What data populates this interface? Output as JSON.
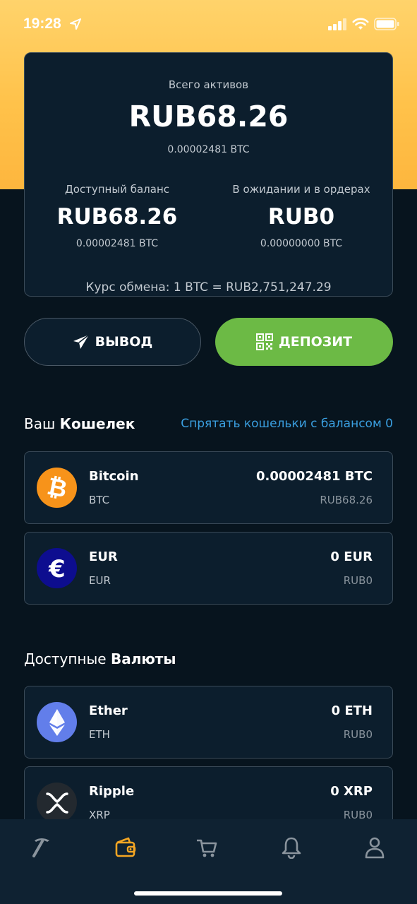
{
  "status_bar": {
    "time": "19:28"
  },
  "summary": {
    "total_label": "Всего активов",
    "total_value": "RUB68.26",
    "total_btc": "0.00002481 BTC",
    "available_label": "Доступный баланс",
    "available_value": "RUB68.26",
    "available_btc": "0.00002481 BTC",
    "pending_label": "В ожидании и в ордерах",
    "pending_value": "RUB0",
    "pending_btc": "0.00000000 BTC",
    "rate": "Курс обмена: 1 BTC = RUB2,751,247.29"
  },
  "actions": {
    "withdraw_label": "ВЫВОД",
    "deposit_label": "ДЕПОЗИТ"
  },
  "wallet_section": {
    "title_prefix": "Ваш",
    "title_bold": "Кошелек",
    "hide_link": "Спрятать кошельки с балансом 0",
    "items": [
      {
        "name": "Bitcoin",
        "symbol": "BTC",
        "balance": "0.00002481 BTC",
        "fiat": "RUB68.26",
        "icon": "bitcoin-icon",
        "color": "#f7931a"
      },
      {
        "name": "EUR",
        "symbol": "EUR",
        "balance": "0 EUR",
        "fiat": "RUB0",
        "icon": "euro-icon",
        "color": "#0d0d8f"
      }
    ]
  },
  "currencies_section": {
    "title_prefix": "Доступные",
    "title_bold": "Валюты",
    "items": [
      {
        "name": "Ether",
        "symbol": "ETH",
        "balance": "0 ETH",
        "fiat": "RUB0",
        "icon": "ethereum-icon",
        "color": "#627eea"
      },
      {
        "name": "Ripple",
        "symbol": "XRP",
        "balance": "0 XRP",
        "fiat": "RUB0",
        "icon": "ripple-icon",
        "color": "#23292f"
      }
    ]
  },
  "tab_bar": {
    "items": [
      {
        "icon": "pickaxe-icon",
        "active": false
      },
      {
        "icon": "wallet-icon",
        "active": true
      },
      {
        "icon": "cart-icon",
        "active": false
      },
      {
        "icon": "bell-icon",
        "active": false
      },
      {
        "icon": "user-icon",
        "active": false
      }
    ],
    "active_color": "#f5a623",
    "inactive_color": "#8a949d"
  },
  "colors": {
    "accent_yellow": "#ffc24a",
    "deposit_green": "#6cba45",
    "link_blue": "#3a9fe0",
    "background": "#07141e",
    "card": "#0c1e2d"
  }
}
